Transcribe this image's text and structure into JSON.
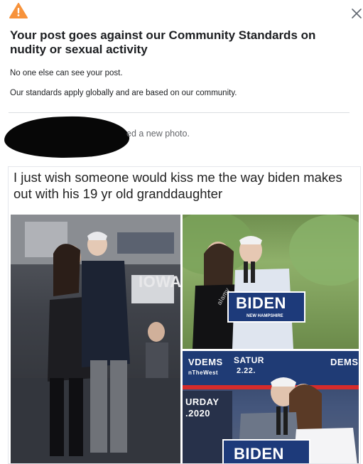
{
  "dialog": {
    "title": "Your post goes against our Community Standards on nudity or sexual activity",
    "line1": "No one else can see your post.",
    "line2": "Our standards apply globally and are based on our community.",
    "close_icon": "close-icon",
    "warning_icon": "warning-icon",
    "warning_color": "#f7923b"
  },
  "post": {
    "caption_fragment": "ed a new photo.",
    "meme_text": "I just wish someone would kiss me the way biden makes out with his 19 yr old granddaughter",
    "photos": [
      {
        "sign_text": "IOWA"
      },
      {
        "sign_text": "BIDEN",
        "sign_sub": "NEW HAMPSHIRE",
        "watermark": "alamy"
      },
      {
        "banner_left": "VDEMS",
        "banner_mid": "SATUR",
        "banner_date": "2.22.",
        "banner_right": "DEMS",
        "left_small": "nTheWest",
        "left_date1": "URDAY",
        "left_date2": ".2020",
        "sign_text": "BIDEN"
      }
    ]
  }
}
